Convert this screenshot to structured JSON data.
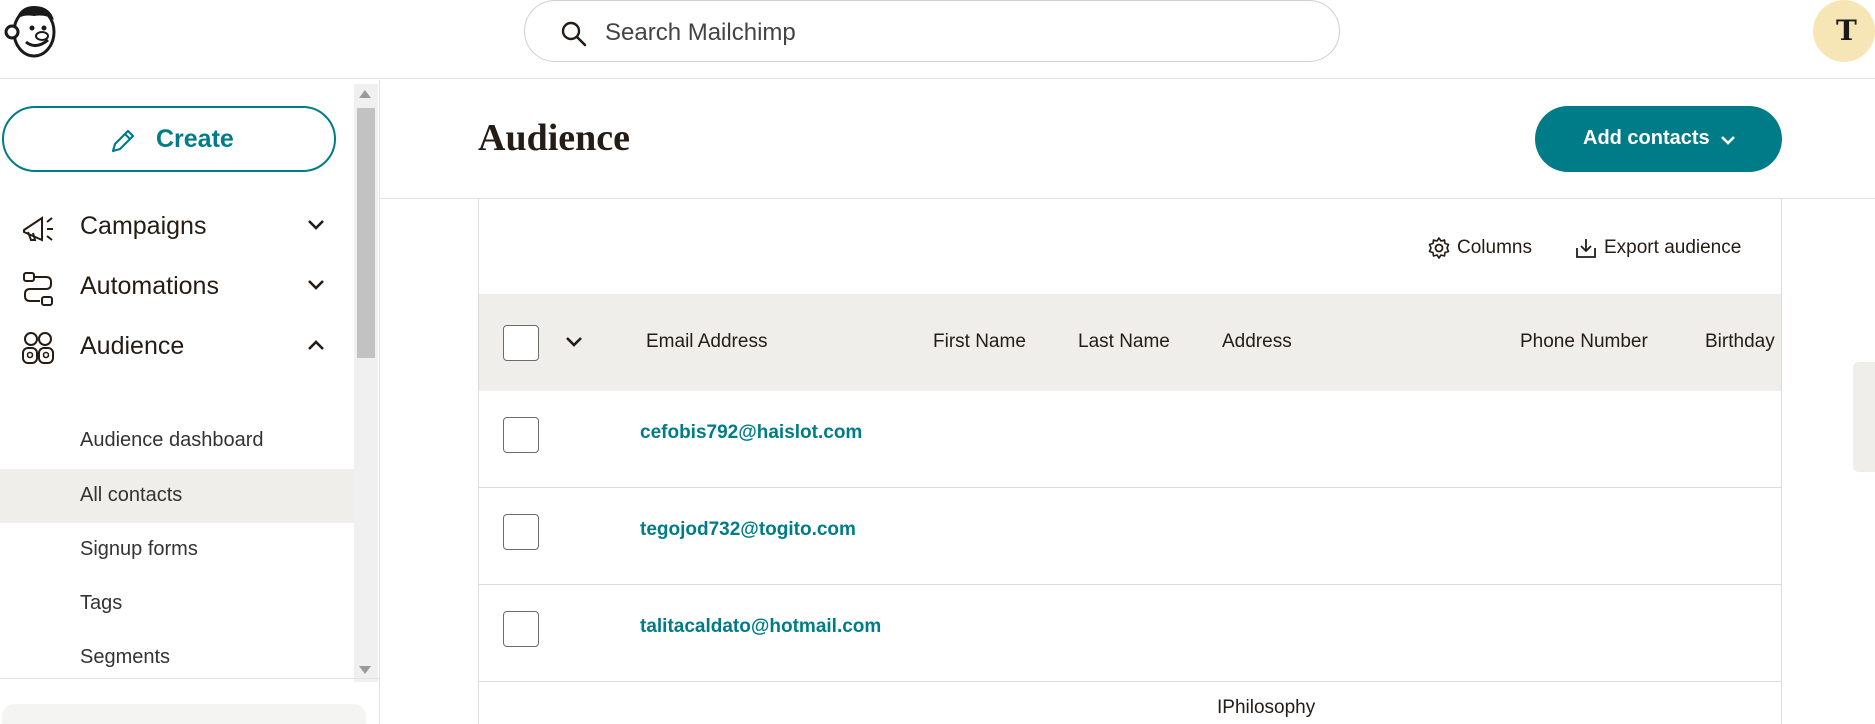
{
  "search": {
    "placeholder": "Search Mailchimp"
  },
  "user": {
    "avatar_initial": "T"
  },
  "sidebar": {
    "create_label": "Create",
    "nav": [
      {
        "label": "Campaigns",
        "icon": "megaphone-icon",
        "expanded": false
      },
      {
        "label": "Automations",
        "icon": "automation-flow-icon",
        "expanded": false
      },
      {
        "label": "Audience",
        "icon": "audience-icon",
        "expanded": true
      }
    ],
    "audience_items": [
      {
        "label": "Audience dashboard"
      },
      {
        "label": "All contacts",
        "active": true
      },
      {
        "label": "Signup forms"
      },
      {
        "label": "Tags"
      },
      {
        "label": "Segments"
      }
    ]
  },
  "main": {
    "title": "Audience",
    "add_contacts_label": "Add contacts",
    "toolbar": {
      "columns_label": "Columns",
      "export_label": "Export audience"
    },
    "table": {
      "headers": [
        "Email Address",
        "First Name",
        "Last Name",
        "Address",
        "Phone Number",
        "Birthday"
      ],
      "rows": [
        {
          "email": "cefobis792@haislot.com"
        },
        {
          "email": "tegojod732@togito.com"
        },
        {
          "email": "talitacaldato@hotmail.com"
        }
      ]
    },
    "footer_text": "IPhilosophy"
  },
  "colors": {
    "accent": "#007c89",
    "header_bg": "#efeeea",
    "text": "#241c15"
  }
}
